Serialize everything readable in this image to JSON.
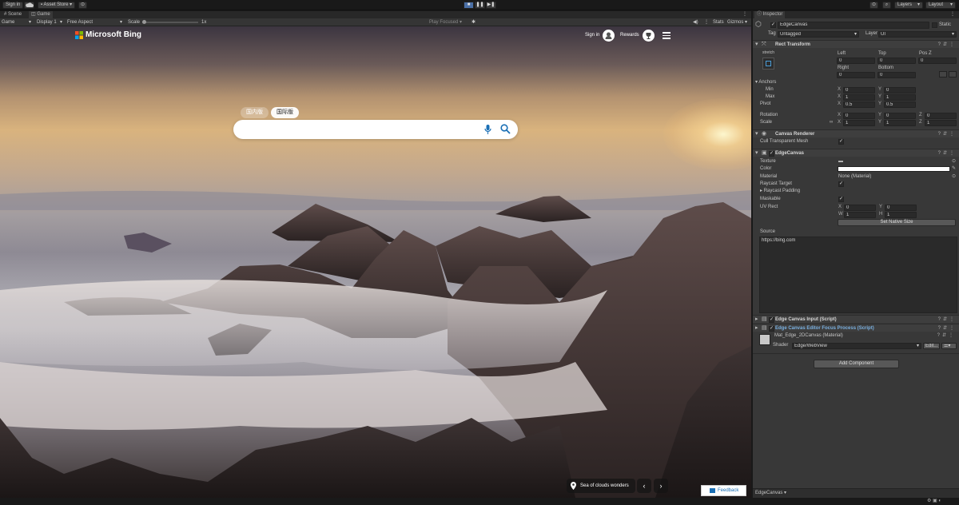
{
  "topbar": {
    "sign_in": "Sign in",
    "cloud_icon": "cloud-icon",
    "asset_store": "Asset Store",
    "layers": "Layers",
    "layout": "Layout"
  },
  "tabs": {
    "scene": "Scene",
    "game": "Game",
    "inspector": "Inspector"
  },
  "game_toolbar": {
    "display_mode": "Game",
    "display": "Display 1",
    "aspect": "Free Aspect",
    "scale_label": "Scale",
    "scale_value": "1x",
    "play_focused": "Play Focused",
    "stats": "Stats",
    "gizmos": "Gizmos"
  },
  "bing": {
    "logo_text": "Microsoft Bing",
    "sign_in": "Sign in",
    "rewards": "Rewards",
    "tab_domestic": "国内版",
    "tab_international": "国际版",
    "search_value": "",
    "caption": "Sea of clouds wonders",
    "feedback": "Feedback"
  },
  "inspector": {
    "object_name": "EdgeCanvas",
    "static_label": "Static",
    "tag_label": "Tag",
    "tag_value": "Untagged",
    "layer_label": "Layer",
    "layer_value": "UI",
    "rect_transform": {
      "title": "Rect Transform",
      "stretch": "stretch",
      "left_label": "Left",
      "top_label": "Top",
      "posz_label": "Pos Z",
      "left": "0",
      "top": "0",
      "posz": "0",
      "right_label": "Right",
      "bottom_label": "Bottom",
      "right": "0",
      "bottom": "0",
      "anchors_label": "Anchors",
      "min_label": "Min",
      "max_label": "Max",
      "min_x": "0",
      "min_y": "0",
      "max_x": "1",
      "max_y": "1",
      "pivot_label": "Pivot",
      "pivot_x": "0.5",
      "pivot_y": "0.5",
      "rotation_label": "Rotation",
      "rot_x": "0",
      "rot_y": "0",
      "rot_z": "0",
      "scale_label": "Scale",
      "scale_x": "1",
      "scale_y": "1",
      "scale_z": "1"
    },
    "canvas_renderer": {
      "title": "Canvas Renderer",
      "cull_label": "Cull Transparent Mesh"
    },
    "edge_canvas": {
      "title": "EdgeCanvas",
      "texture_label": "Texture",
      "color_label": "Color",
      "color_value": "#ffffff",
      "material_label": "Material",
      "material_value": "None (Material)",
      "raycast_target_label": "Raycast Target",
      "raycast_padding_label": "Raycast Padding",
      "maskable_label": "Maskable",
      "uvrect_label": "UV Rect",
      "uv_x": "0",
      "uv_y": "0",
      "uv_w": "1",
      "uv_h": "1",
      "native_size": "Set Native Size",
      "source_label": "Source",
      "source_value": "https://bing.com"
    },
    "edge_canvas_input": "Edge Canvas Input (Script)",
    "edge_canvas_editor_focus": "Edge Canvas Editor Focus Process (Script)",
    "material_name": "Mat_Edge_2DCanvas (Material)",
    "shader_label": "Shader",
    "shader_value": "Edge/WebView",
    "edit_btn": "Edit...",
    "add_component": "Add Component",
    "footer": "EdgeCanvas"
  }
}
